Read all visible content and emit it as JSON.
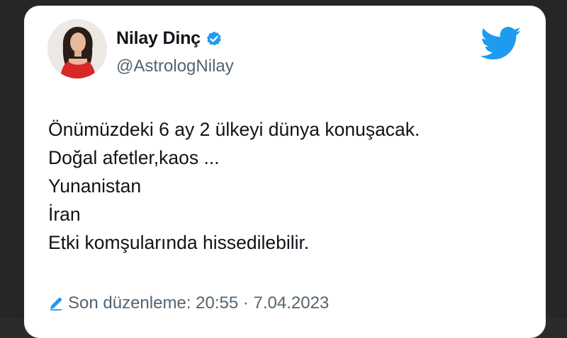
{
  "tweet": {
    "author": {
      "display_name": "Nilay Dinç",
      "handle": "@AstrologNilay",
      "verified": true,
      "avatar_icon": "profile-photo"
    },
    "lines": [
      "Önümüzdeki 6 ay 2 ülkeyi dünya konuşacak.",
      "Doğal afetler,kaos ...",
      "Yunanistan",
      "İran",
      "Etki komşularında hissedilebilir."
    ],
    "edited_label": "Son düzenleme: 20:55 · 7.04.2023",
    "brand_icon": "twitter-bird-icon"
  },
  "colors": {
    "twitter_blue": "#1d9bf0",
    "text_primary": "#0f1419",
    "text_secondary": "#536471",
    "background_outer": "#262626"
  }
}
